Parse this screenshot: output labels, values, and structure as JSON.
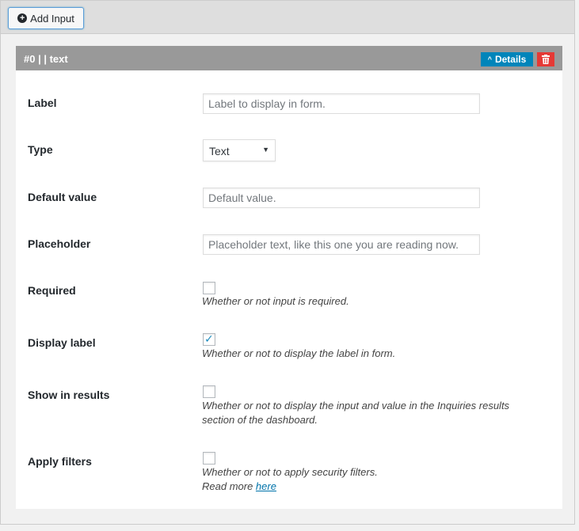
{
  "toolbar": {
    "add_input_label": "Add Input"
  },
  "panel": {
    "title": "#0 | | text",
    "details_label": "Details",
    "colors": {
      "header": "#999999",
      "details": "#0085ba",
      "delete": "#e53935"
    }
  },
  "fields": {
    "label": {
      "label": "Label",
      "placeholder": "Label to display in form.",
      "value": ""
    },
    "type": {
      "label": "Type",
      "selected": "Text"
    },
    "default_value": {
      "label": "Default value",
      "placeholder": "Default value.",
      "value": ""
    },
    "placeholder": {
      "label": "Placeholder",
      "placeholder": "Placeholder text, like this one you are reading now.",
      "value": ""
    },
    "required": {
      "label": "Required",
      "checked": false,
      "hint": "Whether or not input is required."
    },
    "display_label": {
      "label": "Display label",
      "checked": true,
      "hint": "Whether or not to display the label in form."
    },
    "show_in_results": {
      "label": "Show in results",
      "checked": false,
      "hint_line1": "Whether or not to display the input and value in the Inquiries results",
      "hint_line2": "section of the dashboard."
    },
    "apply_filters": {
      "label": "Apply filters",
      "checked": false,
      "hint": "Whether or not to apply security filters.",
      "read_more_prefix": "Read more ",
      "read_more_link": "here"
    }
  }
}
